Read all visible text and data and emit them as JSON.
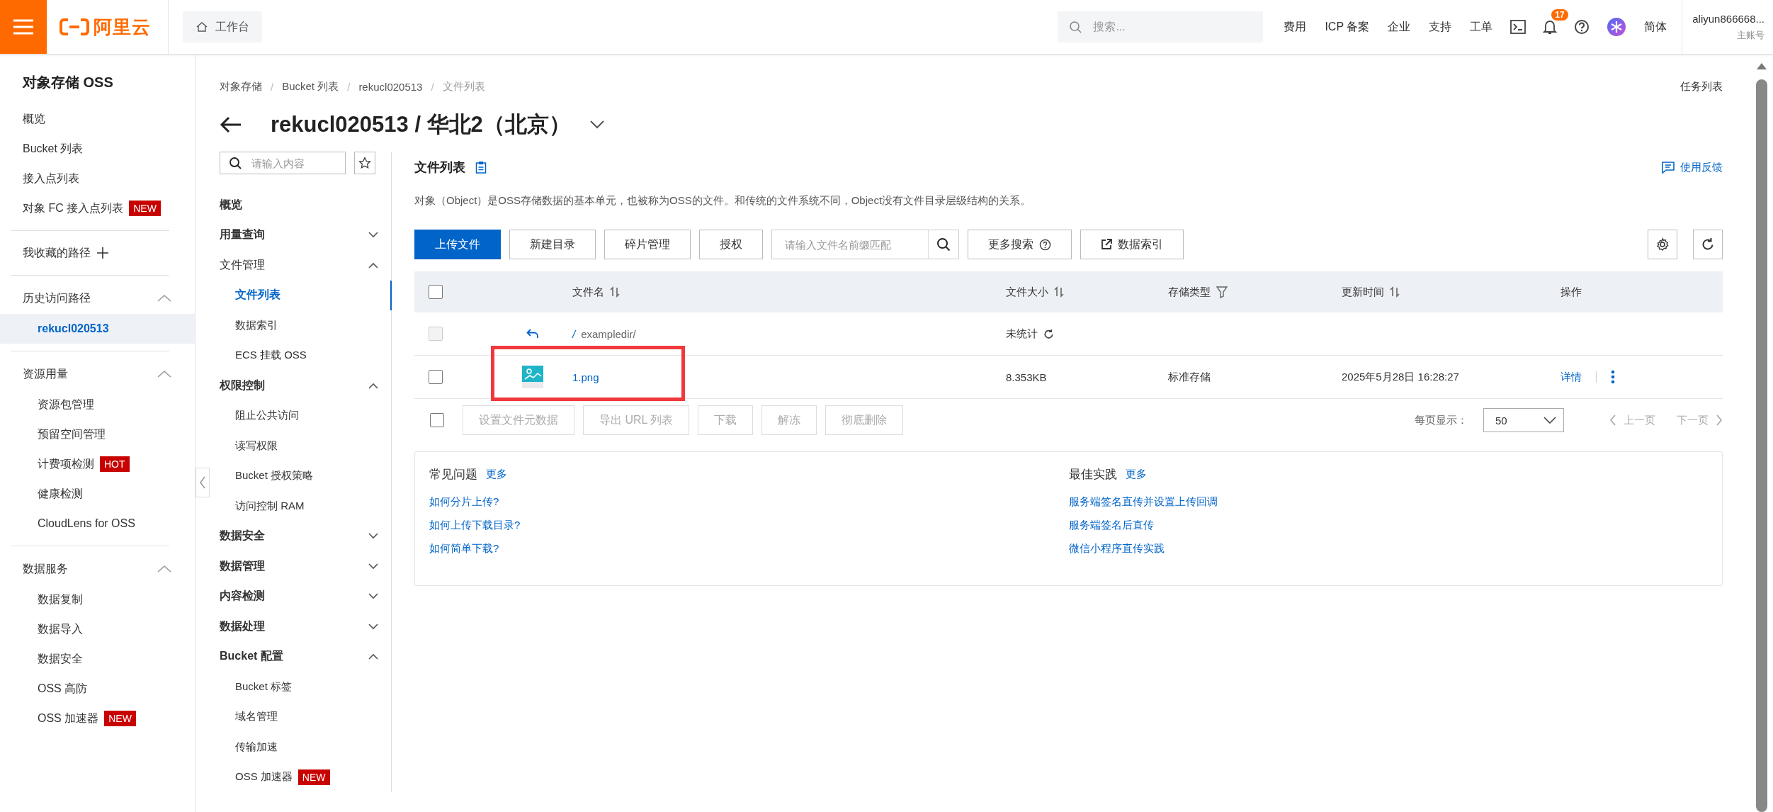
{
  "topbar": {
    "logo_text": "阿里云",
    "workbench": "工作台",
    "search_placeholder": "搜索...",
    "links": [
      "费用",
      "ICP 备案",
      "企业",
      "支持",
      "工单"
    ],
    "notification_count": "17",
    "language": "简体",
    "account": {
      "name": "aliyun866668...",
      "role": "主账号"
    }
  },
  "sidebar": {
    "title": "对象存储 OSS",
    "sections": [
      {
        "kind": "links",
        "items": [
          {
            "label": "概览",
            "selected": false
          },
          {
            "label": "Bucket 列表",
            "selected": false
          },
          {
            "label": "接入点列表",
            "selected": false
          },
          {
            "label": "对象 FC 接入点列表",
            "badge": "NEW",
            "selected": false
          }
        ]
      },
      {
        "kind": "favorites",
        "label": "我收藏的路径"
      },
      {
        "kind": "group",
        "label": "历史访问路径",
        "expanded": true,
        "children": [
          {
            "label": "rekucl020513",
            "selected": true
          }
        ]
      },
      {
        "kind": "group",
        "label": "资源用量",
        "expanded": true,
        "children": [
          {
            "label": "资源包管理",
            "selected": false
          },
          {
            "label": "预留空间管理",
            "selected": false
          },
          {
            "label": "计费项检测",
            "badge": "HOT",
            "selected": false
          },
          {
            "label": "健康检测",
            "selected": false
          },
          {
            "label": "CloudLens for OSS",
            "selected": false
          }
        ]
      },
      {
        "kind": "group",
        "label": "数据服务",
        "expanded": true,
        "children": [
          {
            "label": "数据复制",
            "selected": false
          },
          {
            "label": "数据导入",
            "selected": false
          },
          {
            "label": "数据安全",
            "selected": false
          },
          {
            "label": "OSS 高防",
            "selected": false
          },
          {
            "label": "OSS 加速器",
            "badge": "NEW",
            "selected": false
          }
        ]
      }
    ]
  },
  "breadcrumb": [
    "对象存储",
    "Bucket 列表",
    "rekucl020513",
    "文件列表"
  ],
  "breadcrumb_separator": "/",
  "page_title": "rekucl020513 / 华北2（北京）",
  "task_list": "任务列表",
  "bucket_nav": {
    "search_placeholder": "请输入内容",
    "items": [
      {
        "label": "概览",
        "kind": "link",
        "bold": true
      },
      {
        "label": "用量查询",
        "kind": "group",
        "bold": true,
        "expanded": false
      },
      {
        "label": "文件管理",
        "kind": "group",
        "bold": false,
        "expanded": true,
        "children": [
          {
            "label": "文件列表",
            "selected": true
          },
          {
            "label": "数据索引",
            "selected": false
          },
          {
            "label": "ECS 挂载 OSS",
            "selected": false
          }
        ]
      },
      {
        "label": "权限控制",
        "kind": "group",
        "bold": true,
        "expanded": true,
        "children": [
          {
            "label": "阻止公共访问",
            "selected": false
          },
          {
            "label": "读写权限",
            "selected": false
          },
          {
            "label": "Bucket 授权策略",
            "selected": false
          },
          {
            "label": "访问控制 RAM",
            "selected": false
          }
        ]
      },
      {
        "label": "数据安全",
        "kind": "group",
        "bold": true,
        "expanded": false
      },
      {
        "label": "数据管理",
        "kind": "group",
        "bold": true,
        "expanded": false
      },
      {
        "label": "内容检测",
        "kind": "group",
        "bold": true,
        "expanded": false
      },
      {
        "label": "数据处理",
        "kind": "group",
        "bold": true,
        "expanded": false
      },
      {
        "label": "Bucket 配置",
        "kind": "group",
        "bold": true,
        "expanded": true,
        "children": [
          {
            "label": "Bucket 标签",
            "selected": false
          },
          {
            "label": "域名管理",
            "selected": false
          },
          {
            "label": "传输加速",
            "selected": false
          },
          {
            "label": "OSS 加速器",
            "badge": "NEW",
            "selected": false
          }
        ]
      }
    ]
  },
  "file_list": {
    "heading": "文件列表",
    "feedback": "使用反馈",
    "description": "对象（Object）是OSS存储数据的基本单元，也被称为OSS的文件。和传统的文件系统不同，Object没有文件目录层级结构的关系。",
    "toolbar": {
      "buttons": [
        {
          "label": "上传文件",
          "primary": true
        },
        {
          "label": "新建目录",
          "primary": false
        },
        {
          "label": "碎片管理",
          "primary": false
        },
        {
          "label": "授权",
          "primary": false
        }
      ],
      "search_placeholder": "请输入文件名前缀匹配",
      "more_search": "更多搜索",
      "data_index": "数据索引"
    },
    "table": {
      "columns": [
        {
          "label": "文件名",
          "sortable": true,
          "filterable": false
        },
        {
          "label": "文件大小",
          "sortable": true,
          "filterable": false
        },
        {
          "label": "存储类型",
          "sortable": false,
          "filterable": true
        },
        {
          "label": "更新时间",
          "sortable": true,
          "filterable": false
        },
        {
          "label": "操作"
        }
      ],
      "header_checked": false,
      "rows": [
        {
          "kind": "parent",
          "prefix": "/",
          "name": "exampledir/",
          "size": "未统计",
          "checked": false,
          "disabled": true
        },
        {
          "kind": "file",
          "name": "1.png",
          "size": "8.353KB",
          "storage": "标准存储",
          "time": "2025年5月28日 16:28:27",
          "action": "详情",
          "checked": false,
          "disabled": false
        }
      ]
    },
    "bulk": {
      "checked": false,
      "buttons": [
        {
          "label": "设置文件元数据",
          "disabled": true
        },
        {
          "label": "导出 URL 列表",
          "disabled": true
        },
        {
          "label": "下载",
          "disabled": true
        },
        {
          "label": "解冻",
          "disabled": true
        },
        {
          "label": "彻底删除",
          "disabled": true
        }
      ]
    },
    "pagination": {
      "label": "每页显示：",
      "page_size": "50",
      "prev": {
        "label": "上一页",
        "disabled": true
      },
      "next": {
        "label": "下一页",
        "disabled": true
      }
    },
    "help": [
      {
        "title": "常见问题",
        "more": "更多",
        "links": [
          "如何分片上传?",
          "如何上传下载目录?",
          "如何简单下载?"
        ]
      },
      {
        "title": "最佳实践",
        "more": "更多",
        "links": [
          "服务端签名直传并设置上传回调",
          "服务端签名后直传",
          "微信小程序直传实践"
        ]
      }
    ]
  },
  "highlight": {
    "kind": "frame"
  }
}
